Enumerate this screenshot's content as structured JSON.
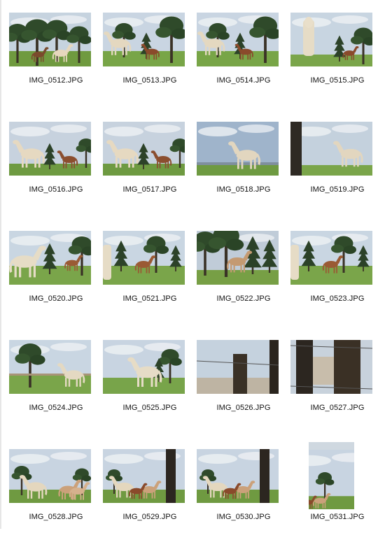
{
  "view": {
    "type": "file-explorer-thumbnails"
  },
  "files": [
    {
      "name": "IMG_0512.JPG",
      "scene": "trees-two-horses"
    },
    {
      "name": "IMG_0513.JPG",
      "scene": "white-horse-brown-horse"
    },
    {
      "name": "IMG_0514.JPG",
      "scene": "white-horse-brown-horse"
    },
    {
      "name": "IMG_0515.JPG",
      "scene": "white-horse-closeup"
    },
    {
      "name": "IMG_0516.JPG",
      "scene": "horse-grazing-pair"
    },
    {
      "name": "IMG_0517.JPG",
      "scene": "horse-grazing-pair"
    },
    {
      "name": "IMG_0518.JPG",
      "scene": "white-horse-side"
    },
    {
      "name": "IMG_0519.JPG",
      "scene": "white-horse-post"
    },
    {
      "name": "IMG_0520.JPG",
      "scene": "white-horse-walk"
    },
    {
      "name": "IMG_0521.JPG",
      "scene": "brown-foal-field"
    },
    {
      "name": "IMG_0522.JPG",
      "scene": "tall-trees-horse"
    },
    {
      "name": "IMG_0523.JPG",
      "scene": "brown-foal-field"
    },
    {
      "name": "IMG_0524.JPG",
      "scene": "white-horse-fence"
    },
    {
      "name": "IMG_0525.JPG",
      "scene": "white-horse-standing"
    },
    {
      "name": "IMG_0526.JPG",
      "scene": "fence-post-wire"
    },
    {
      "name": "IMG_0527.JPG",
      "scene": "fence-post-wire-2"
    },
    {
      "name": "IMG_0528.JPG",
      "scene": "herd-grazing"
    },
    {
      "name": "IMG_0529.JPG",
      "scene": "herd-grazing-post"
    },
    {
      "name": "IMG_0530.JPG",
      "scene": "herd-grazing-post"
    },
    {
      "name": "IMG_0531.JPG",
      "scene": "herd-portrait"
    }
  ]
}
